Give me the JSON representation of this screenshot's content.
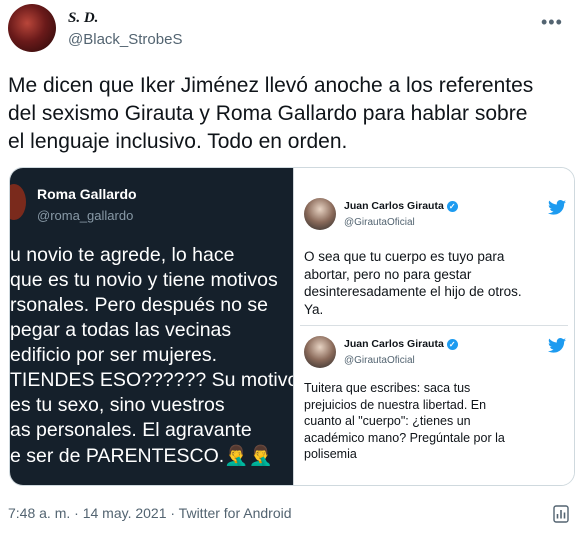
{
  "author": {
    "name": "S. D.",
    "handle": "@Black_StrobeS"
  },
  "tweet": {
    "lines": [
      "Me dicen que Iker Jiménez llevó anoche a los referentes",
      "del sexismo Girauta y Roma Gallardo para hablar sobre",
      "el lenguaje inclusivo. Todo en orden."
    ]
  },
  "left_image": {
    "name": "Roma Gallardo",
    "handle": "@roma_gallardo",
    "lines": [
      "u novio te agrede, lo hace",
      "que es tu novio y tiene motivos",
      "rsonales. Pero después no se",
      "pegar a todas las vecinas",
      "edificio por ser mujeres.",
      "TIENDES ESO?????? Su motivo",
      "es tu sexo, sino vuestros",
      "as personales. El agravante",
      "e ser de PARENTESCO.🤦‍♂️🤦‍♂️"
    ]
  },
  "right_image": {
    "cards": [
      {
        "name": "Juan Carlos Girauta",
        "handle": "@GirautaOficial",
        "lines": [
          "O sea que tu cuerpo es tuyo para",
          "abortar, pero no para gestar",
          "desinteresadamente el hijo de otros.",
          "Ya."
        ]
      },
      {
        "name": "Juan Carlos Girauta",
        "handle": "@GirautaOficial",
        "lines": [
          "Tuitera que escribes: saca tus",
          "prejuicios de nuestra libertad. En",
          "cuanto al \"cuerpo\": ¿tienes un",
          "académico mano? Pregúntale por la",
          "polisemia"
        ]
      }
    ]
  },
  "footer": {
    "timestamp": "7:48 a. m. · 14 may. 2021 · Twitter for Android"
  },
  "icons": {
    "more": "more-icon",
    "twitter": "twitter-bird-icon",
    "analytics": "analytics-icon",
    "verified": "verified-badge-icon"
  },
  "colors": {
    "accent": "#1d9bf0",
    "dark_bg": "#15202b",
    "muted": "#536471"
  }
}
